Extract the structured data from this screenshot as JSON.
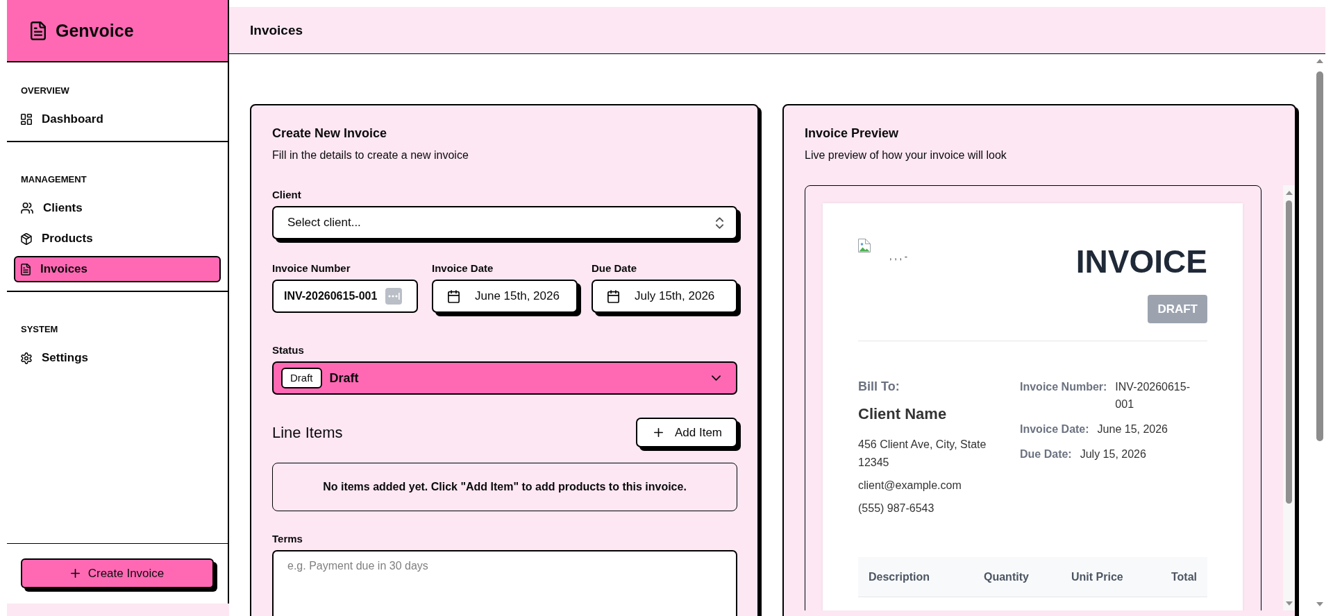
{
  "sidebar": {
    "brand": "Genvoice",
    "sections": [
      {
        "heading": "OVERVIEW",
        "items": [
          {
            "label": "Dashboard",
            "selected": false
          }
        ]
      },
      {
        "heading": "MANAGEMENT",
        "items": [
          {
            "label": "Clients",
            "selected": false
          },
          {
            "label": "Products",
            "selected": false
          },
          {
            "label": "Invoices",
            "selected": true
          }
        ]
      },
      {
        "heading": "SYSTEM",
        "items": [
          {
            "label": "Settings",
            "selected": false
          }
        ]
      }
    ],
    "create_button": "Create Invoice"
  },
  "header": {
    "title": "Invoices"
  },
  "form": {
    "title": "Create New Invoice",
    "subtitle": "Fill in the details to create a new invoice",
    "client": {
      "label": "Client",
      "placeholder": "Select client..."
    },
    "invoice_number": {
      "label": "Invoice Number",
      "value": "INV-20260615-001"
    },
    "invoice_date": {
      "label": "Invoice Date",
      "value": "June 15th, 2026"
    },
    "due_date": {
      "label": "Due Date",
      "value": "July 15th, 2026"
    },
    "status": {
      "label": "Status",
      "badge": "Draft",
      "value": "Draft"
    },
    "line_items": {
      "title": "Line Items",
      "add_button": "Add Item",
      "empty_message": "No items added yet. Click \"Add Item\" to add products to this invoice."
    },
    "terms": {
      "label": "Terms",
      "placeholder": "e.g. Payment due in 30 days"
    }
  },
  "preview": {
    "title": "Invoice Preview",
    "subtitle": "Live preview of how your invoice will look",
    "document": {
      "logo_alt": ", , , -",
      "heading": "INVOICE",
      "status_badge": "DRAFT",
      "bill_to": {
        "label": "Bill To:",
        "name": "Client Name",
        "address": "456 Client Ave, City, State 12345",
        "email": "client@example.com",
        "phone": "(555) 987-6543"
      },
      "details": [
        {
          "label": "Invoice Number:",
          "value": "INV-20260615-001"
        },
        {
          "label": "Invoice Date:",
          "value": "June 15, 2026"
        },
        {
          "label": "Due Date:",
          "value": "July 15, 2026"
        }
      ],
      "table": {
        "columns": [
          "Description",
          "Quantity",
          "Unit Price",
          "Total"
        ]
      }
    }
  }
}
